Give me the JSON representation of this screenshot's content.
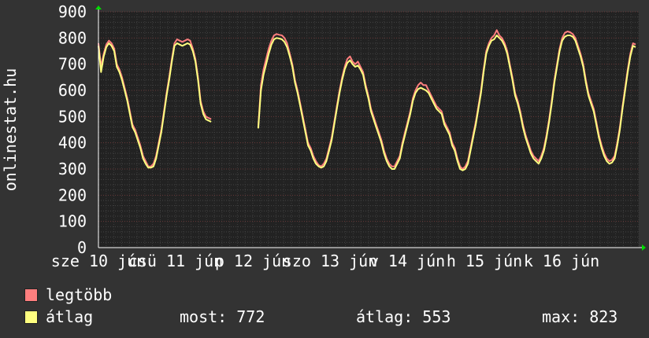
{
  "chart_data": {
    "type": "line",
    "ylabel": "onlinestat.hu",
    "ylim": [
      0,
      900
    ],
    "yticks": [
      0,
      100,
      200,
      300,
      400,
      500,
      600,
      700,
      800,
      900
    ],
    "xtick_labels": [
      "sze 10 jún",
      "csü 11 jún",
      "p 12 jún",
      "szo 13 jún",
      "v 14 jún",
      "h 15 jún",
      "k 16 jún"
    ],
    "grid": true,
    "series": [
      {
        "name": "legtöbb",
        "color": "#ff7f7f",
        "values": [
          780,
          690,
          740,
          775,
          790,
          780,
          760,
          700,
          680,
          650,
          610,
          570,
          520,
          470,
          450,
          420,
          390,
          350,
          330,
          310,
          310,
          320,
          350,
          400,
          450,
          520,
          590,
          650,
          720,
          780,
          795,
          790,
          785,
          790,
          795,
          790,
          760,
          720,
          650,
          560,
          520,
          500,
          495,
          490,
          null,
          null,
          null,
          null,
          null,
          null,
          null,
          null,
          null,
          null,
          null,
          null,
          null,
          null,
          null,
          null,
          null,
          460,
          620,
          680,
          720,
          760,
          790,
          810,
          815,
          812,
          810,
          800,
          780,
          740,
          700,
          640,
          600,
          550,
          500,
          450,
          400,
          380,
          350,
          330,
          315,
          310,
          320,
          340,
          380,
          420,
          480,
          540,
          600,
          650,
          690,
          720,
          730,
          710,
          700,
          710,
          690,
          670,
          620,
          580,
          530,
          500,
          470,
          440,
          410,
          370,
          340,
          320,
          310,
          310,
          330,
          350,
          400,
          440,
          480,
          520,
          570,
          600,
          620,
          630,
          620,
          620,
          600,
          580,
          560,
          540,
          530,
          520,
          480,
          460,
          440,
          400,
          380,
          340,
          310,
          300,
          310,
          330,
          380,
          430,
          480,
          540,
          600,
          680,
          750,
          780,
          800,
          810,
          830,
          810,
          800,
          780,
          750,
          700,
          650,
          590,
          560,
          520,
          470,
          430,
          400,
          370,
          350,
          340,
          330,
          350,
          380,
          430,
          490,
          560,
          640,
          700,
          760,
          800,
          820,
          825,
          822,
          815,
          800,
          770,
          740,
          700,
          640,
          590,
          560,
          530,
          480,
          430,
          390,
          360,
          340,
          330,
          335,
          350,
          400,
          460,
          540,
          610,
          680,
          740,
          780,
          775
        ]
      },
      {
        "name": "átlag",
        "color": "#ffff80",
        "values": [
          770,
          670,
          730,
          765,
          780,
          770,
          750,
          690,
          670,
          640,
          600,
          560,
          510,
          460,
          440,
          410,
          380,
          340,
          320,
          305,
          305,
          310,
          340,
          390,
          440,
          510,
          580,
          640,
          710,
          770,
          780,
          775,
          770,
          775,
          780,
          775,
          750,
          710,
          640,
          550,
          510,
          490,
          485,
          480,
          null,
          null,
          null,
          null,
          null,
          null,
          null,
          null,
          null,
          null,
          null,
          null,
          null,
          null,
          null,
          null,
          null,
          455,
          600,
          660,
          700,
          740,
          775,
          795,
          800,
          798,
          795,
          785,
          765,
          730,
          690,
          630,
          590,
          540,
          490,
          440,
          390,
          370,
          340,
          320,
          310,
          305,
          310,
          330,
          370,
          410,
          470,
          530,
          590,
          640,
          680,
          705,
          715,
          700,
          690,
          695,
          680,
          660,
          610,
          570,
          520,
          490,
          460,
          430,
          400,
          360,
          330,
          310,
          300,
          300,
          320,
          340,
          390,
          430,
          470,
          510,
          560,
          590,
          605,
          610,
          605,
          600,
          590,
          570,
          550,
          530,
          520,
          510,
          470,
          450,
          430,
          390,
          370,
          330,
          300,
          295,
          300,
          320,
          370,
          420,
          470,
          530,
          590,
          670,
          740,
          770,
          790,
          795,
          810,
          800,
          790,
          770,
          740,
          690,
          640,
          580,
          550,
          510,
          460,
          420,
          390,
          360,
          340,
          330,
          320,
          340,
          370,
          420,
          480,
          550,
          630,
          690,
          750,
          790,
          805,
          810,
          810,
          805,
          790,
          760,
          730,
          690,
          630,
          580,
          550,
          520,
          470,
          420,
          380,
          350,
          330,
          320,
          325,
          340,
          390,
          450,
          530,
          600,
          670,
          730,
          770,
          765
        ]
      }
    ]
  },
  "legend": {
    "items": [
      {
        "label": "legtöbb",
        "color": "#ff7f7f"
      },
      {
        "label": "átlag",
        "color": "#ffff80"
      }
    ]
  },
  "stats": {
    "most": "most: 772",
    "atlag": "átlag: 553",
    "max": "max: 823"
  }
}
